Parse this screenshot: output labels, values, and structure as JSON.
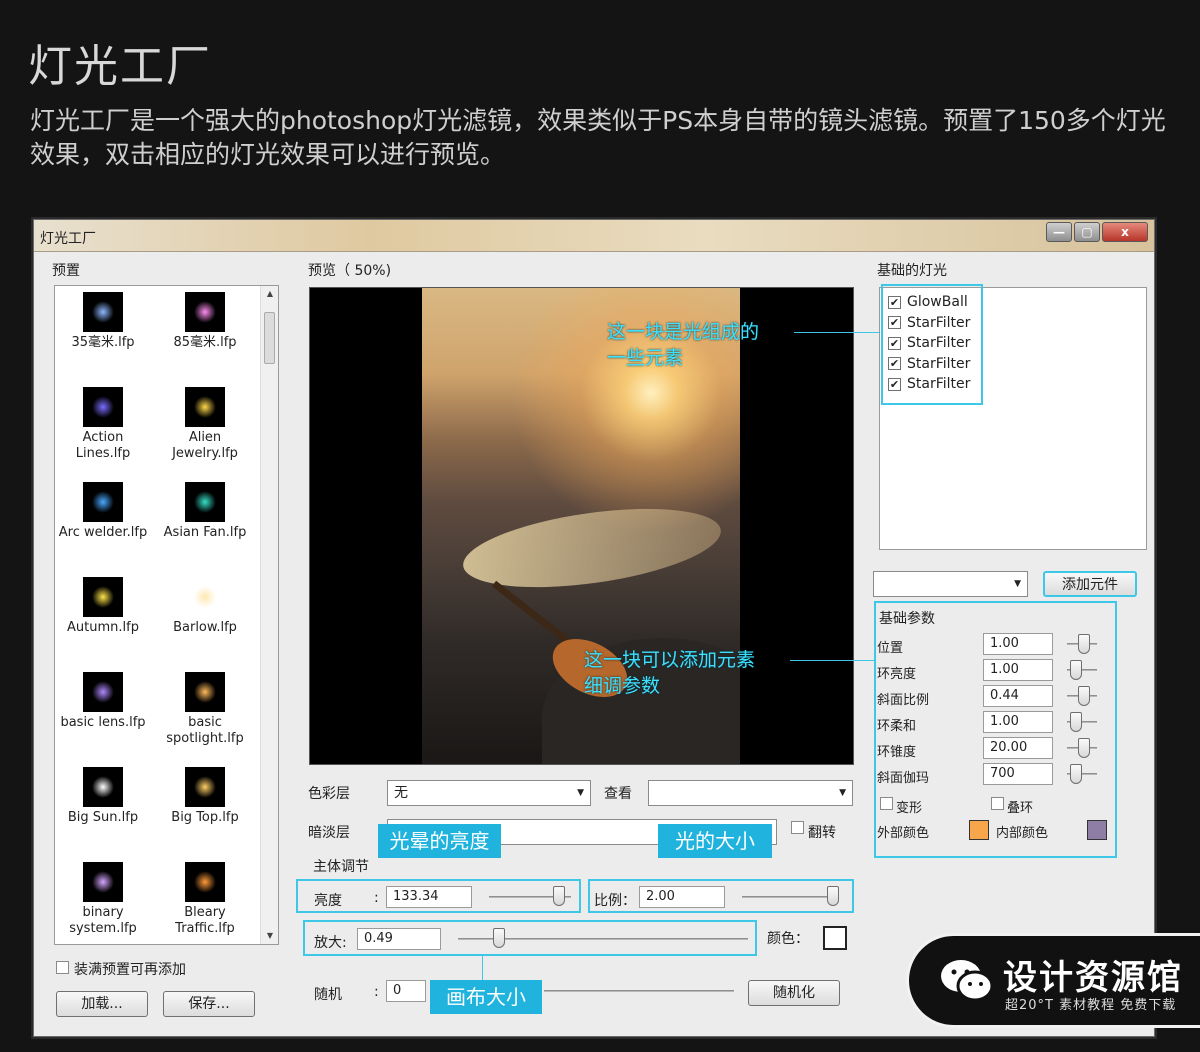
{
  "header": {
    "title": "灯光工厂",
    "description": "灯光工厂是一个强大的photoshop灯光滤镜，效果类似于PS本身自带的镜头滤镜。预置了150多个灯光效果，双击相应的灯光效果可以进行预览。"
  },
  "window": {
    "title": "灯光工厂",
    "controls": {
      "minimize": "—",
      "maximize": "▢",
      "close": "x"
    }
  },
  "presets": {
    "label": "预置",
    "items": [
      {
        "name": "35毫米.lfp",
        "icon": "lens-flare-icon"
      },
      {
        "name": "85毫米.lfp",
        "icon": "lens-flare-icon"
      },
      {
        "name": "Action Lines.lfp",
        "icon": "lens-flare-icon"
      },
      {
        "name": "Alien Jewelry.lfp",
        "icon": "lens-flare-icon"
      },
      {
        "name": "Arc welder.lfp",
        "icon": "lens-flare-icon"
      },
      {
        "name": "Asian Fan.lfp",
        "icon": "lens-flare-icon"
      },
      {
        "name": "Autumn.lfp",
        "icon": "lens-flare-icon"
      },
      {
        "name": "Barlow.lfp",
        "icon": "lens-flare-icon"
      },
      {
        "name": "basic lens.lfp",
        "icon": "lens-flare-icon"
      },
      {
        "name": "basic spotlight.lfp",
        "icon": "lens-flare-icon"
      },
      {
        "name": "Big Sun.lfp",
        "icon": "lens-flare-icon"
      },
      {
        "name": "Big Top.lfp",
        "icon": "lens-flare-icon"
      },
      {
        "name": "binary system.lfp",
        "icon": "lens-flare-icon"
      },
      {
        "name": "Bleary Traffic.lfp",
        "icon": "lens-flare-icon"
      }
    ],
    "add_all_label": "装满预置可再添加",
    "load_button": "加载...",
    "save_button": "保存..."
  },
  "preview": {
    "label": "预览（  50%)",
    "annotation_top": "这一块是光组成的\n一些元素",
    "annotation_mid": "这一块可以添加元素\n细调参数"
  },
  "controls": {
    "color_layer_label": "色彩层",
    "color_layer_value": "无",
    "view_label": "查看",
    "view_value": "",
    "dim_layer_label": "暗淡层",
    "flip_label": "翻转",
    "main_adjust_label": "主体调节",
    "brightness_label": "亮度",
    "brightness_value": "133.34",
    "brightness_level": 0.85,
    "ratio_label": "比例：",
    "ratio_value": "2.00",
    "ratio_level": 0.95,
    "zoom_label": "放大:",
    "zoom_value": "0.49",
    "zoom_level": 0.14,
    "color_label": "颜色：",
    "random_label": "随机",
    "random_value": "0",
    "randomize_button": "随机化",
    "tag_brightness": "光晕的亮度",
    "tag_size": "光的大小",
    "tag_canvas": "画布大小",
    "colon": ":"
  },
  "lights": {
    "label": "基础的灯光",
    "items": [
      "GlowBall",
      "StarFilter",
      "StarFilter",
      "StarFilter",
      "StarFilter"
    ],
    "check_mark": "✔",
    "dropdown_value": "",
    "add_button": "添加元件"
  },
  "params": {
    "label": "基础参数",
    "rows": [
      {
        "label": "位置",
        "value": "1.00"
      },
      {
        "label": "环亮度",
        "value": "1.00"
      },
      {
        "label": "斜面比例",
        "value": "0.44"
      },
      {
        "label": "环柔和",
        "value": "1.00"
      },
      {
        "label": "环锥度",
        "value": "20.00"
      },
      {
        "label": "斜面伽玛",
        "value": "700"
      }
    ],
    "deform_label": "变形",
    "stack_label": "叠环",
    "outer_color_label": "外部颜色",
    "inner_color_label": "内部颜色",
    "outer_color": "#f7a64c",
    "inner_color": "#8e7ea6"
  },
  "watermark": {
    "title": "设计资源馆",
    "subtitle": "超20°T 素材教程 免费下载"
  }
}
